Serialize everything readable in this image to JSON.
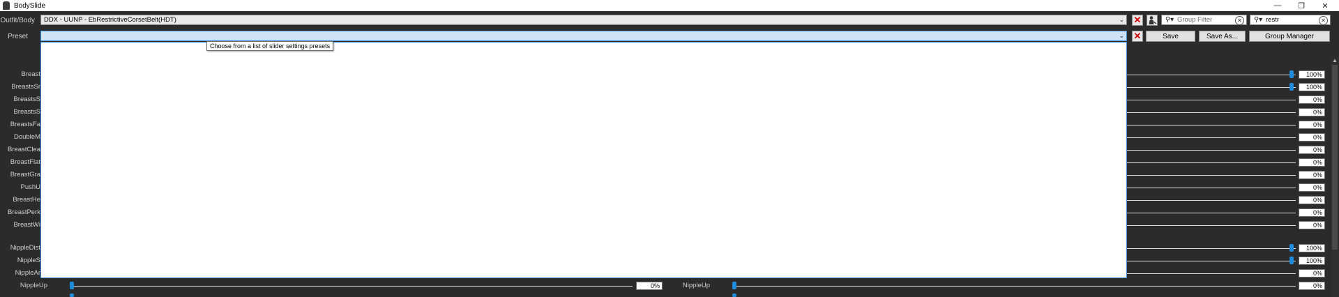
{
  "window": {
    "title": "BodySlide",
    "controls": [
      "—",
      "❐",
      "✕"
    ]
  },
  "outfit": {
    "label": "Outfit/Body",
    "value": "DDX - UUNP - EbRestrictiveCorsetBelt(HDT)"
  },
  "preset": {
    "label": "Preset",
    "value": "",
    "tooltip": "Choose from a list of slider settings presets"
  },
  "group_filter": {
    "placeholder": "Group Filter",
    "value": ""
  },
  "outfit_filter": {
    "value": "restr"
  },
  "buttons": {
    "save": "Save",
    "save_as": "Save As...",
    "group_manager": "Group Manager"
  },
  "sliders_group1": [
    {
      "label": "Breast",
      "value": "100%",
      "level": 1.0
    },
    {
      "label": "BreastsSr",
      "value": "100%",
      "level": 1.0
    },
    {
      "label": "BreastsS",
      "value": "0%",
      "level": 0
    },
    {
      "label": "BreastsS",
      "value": "0%",
      "level": 0
    },
    {
      "label": "BreastsFa",
      "value": "0%",
      "level": 0
    },
    {
      "label": "DoubleM",
      "value": "0%",
      "level": 0
    },
    {
      "label": "BreastClea",
      "value": "0%",
      "level": 0
    },
    {
      "label": "BreastFlat",
      "value": "0%",
      "level": 0
    },
    {
      "label": "BreastGra",
      "value": "0%",
      "level": 0
    },
    {
      "label": "PushU",
      "value": "0%",
      "level": 0
    },
    {
      "label": "BreastHe",
      "value": "0%",
      "level": 0
    },
    {
      "label": "BreastPerk",
      "value": "0%",
      "level": 0
    },
    {
      "label": "BreastWi",
      "value": "0%",
      "level": 0
    }
  ],
  "sliders_group2": [
    {
      "label": "NippleDist",
      "value": "100%",
      "level": 1.0
    },
    {
      "label": "NippleS",
      "value": "100%",
      "level": 1.0
    },
    {
      "label": "NippleAr",
      "value": "0%",
      "level": 0
    }
  ],
  "nipple_up": {
    "left_label": "NippleUp",
    "left_value": "0%",
    "right_label": "NippleUp",
    "right_value": "0%"
  },
  "colors": {
    "accent": "#1f8bdc",
    "background": "#2b2b2b",
    "clear_red": "#d10000"
  }
}
